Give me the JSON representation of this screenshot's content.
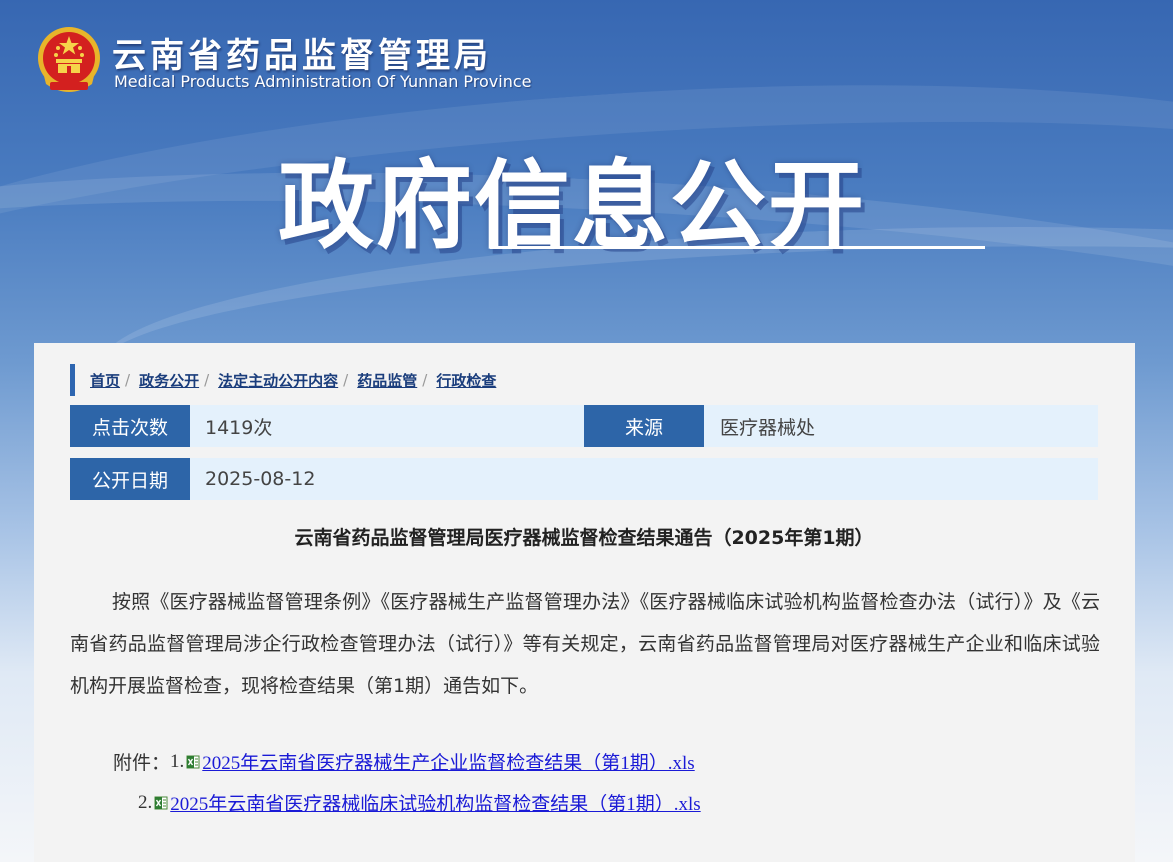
{
  "header": {
    "site_name_cn": "云南省药品监督管理局",
    "site_name_en": "Medical Products Administration Of Yunnan Province",
    "banner_title": "政府信息公开",
    "emblem_icon": "national-emblem-icon"
  },
  "breadcrumb": [
    {
      "label": "首页"
    },
    {
      "label": "政务公开"
    },
    {
      "label": "法定主动公开内容"
    },
    {
      "label": "药品监管"
    },
    {
      "label": "行政检查"
    }
  ],
  "info": {
    "clicks_label": "点击次数",
    "clicks_value": "1419次",
    "source_label": "来源",
    "source_value": "医疗器械处",
    "date_label": "公开日期",
    "date_value": "2025-08-12"
  },
  "article": {
    "title": "云南省药品监督管理局医疗器械监督检查结果通告（2025年第1期）",
    "body": "按照《医疗器械监督管理条例》《医疗器械生产监督管理办法》《医疗器械临床试验机构监督检查办法（试行）》及《云南省药品监督管理局涉企行政检查管理办法（试行）》等有关规定，云南省药品监督管理局对医疗器械生产企业和临床试验机构开展监督检查，现将检查结果（第1期）通告如下。",
    "attachments_label": "附件：",
    "attachments": [
      {
        "index": "1.",
        "name": "2025年云南省医疗器械生产企业监督检查结果（第1期）.xls",
        "icon": "excel-file-icon"
      },
      {
        "index": "2.",
        "name": "2025年云南省医疗器械临床试验机构监督检查结果（第1期）.xls",
        "icon": "excel-file-icon"
      }
    ]
  },
  "colors": {
    "label_bg": "#2d65a8",
    "row_bg": "#e4f1fc",
    "link": "#1a1ad6",
    "breadcrumb_link": "#1a3d7c"
  }
}
